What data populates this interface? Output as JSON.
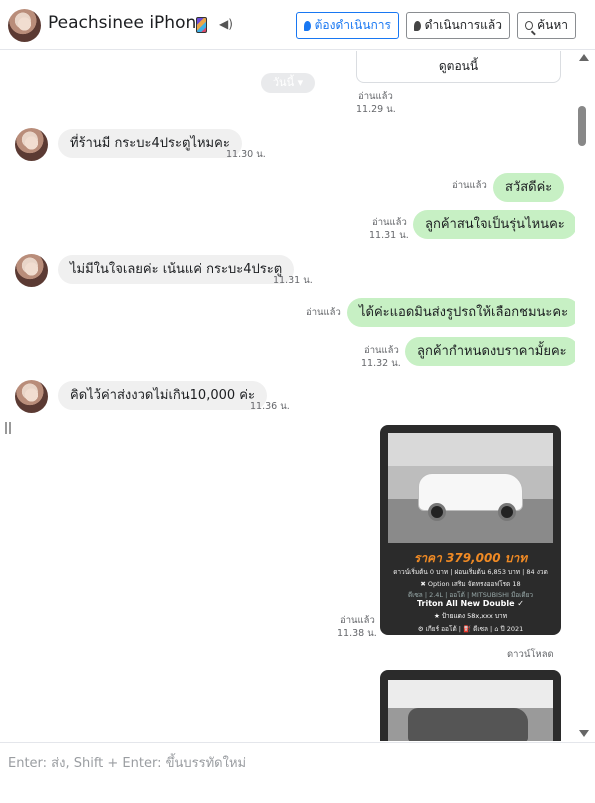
{
  "header": {
    "contact_name": "Peachsinee iPhone",
    "buttons": {
      "todo": "ต้องดำเนินการ",
      "done": "ดำเนินการแล้ว",
      "search": "ค้นหา"
    }
  },
  "thread": {
    "top_card_link": "ดูตอนนี้",
    "top_card_status": "อ่านแล้ว",
    "top_card_time": "11.29 น.",
    "day_divider": "วันนี้ ▾",
    "messages": [
      {
        "direction": "incoming",
        "text": "ที่ร้านมี กระบะ4ประตูไหมคะ",
        "time": "11.30 น."
      },
      {
        "direction": "outgoing",
        "text": "สวัสดีค่ะ",
        "status": "อ่านแล้ว",
        "time": ""
      },
      {
        "direction": "outgoing",
        "text": "ลูกค้าสนใจเป็นรุ่นไหนคะ",
        "status": "อ่านแล้ว",
        "time": "11.31 น."
      },
      {
        "direction": "incoming",
        "text": "ไม่มีในใจเลยค่ะ เน้นแค่ กระบะ4ประตู",
        "time": "11.31 น."
      },
      {
        "direction": "outgoing",
        "text": "ได้ค่ะแอดมินส่งรูปรถให้เลือกชมนะคะ",
        "status": "อ่านแล้ว",
        "time": ""
      },
      {
        "direction": "outgoing",
        "text": "ลูกค้ากำหนดงบราคามั้ยคะ",
        "status": "อ่านแล้ว",
        "time": "11.32 น."
      },
      {
        "direction": "incoming",
        "text": "คิดไว้ค่าส่งงวดไม่เกิน10,000 ค่ะ",
        "time": "11.36 น."
      }
    ],
    "image_card_1": {
      "status": "อ่านแล้ว",
      "time": "11.38 น.",
      "price": "ราคา 379,000 บาท",
      "line1": "ดาวน์เริ่มต้น 0 บาท | ผ่อนเริ่มต้น 6,853 บาท | 84 งวด",
      "line2": "✖ Option เสริม จัดทรงออฟโรด 18",
      "line3": "ดีเซล | 2.4L | ออโต้ | MITSUBISHI มือเดียว",
      "model": "Triton All New Double ✓",
      "line4": "★ ป้ายแดง 58x,xxx บาท",
      "line5": "⚙ เกียร์ ออโต้ | ⛽ ดีเซล | ⌂ ปี 2021"
    },
    "download_label": "ดาวน์โหลด"
  },
  "composer": {
    "placeholder": "Enter: ส่ง, Shift + Enter: ขึ้นบรรทัดใหม่"
  }
}
